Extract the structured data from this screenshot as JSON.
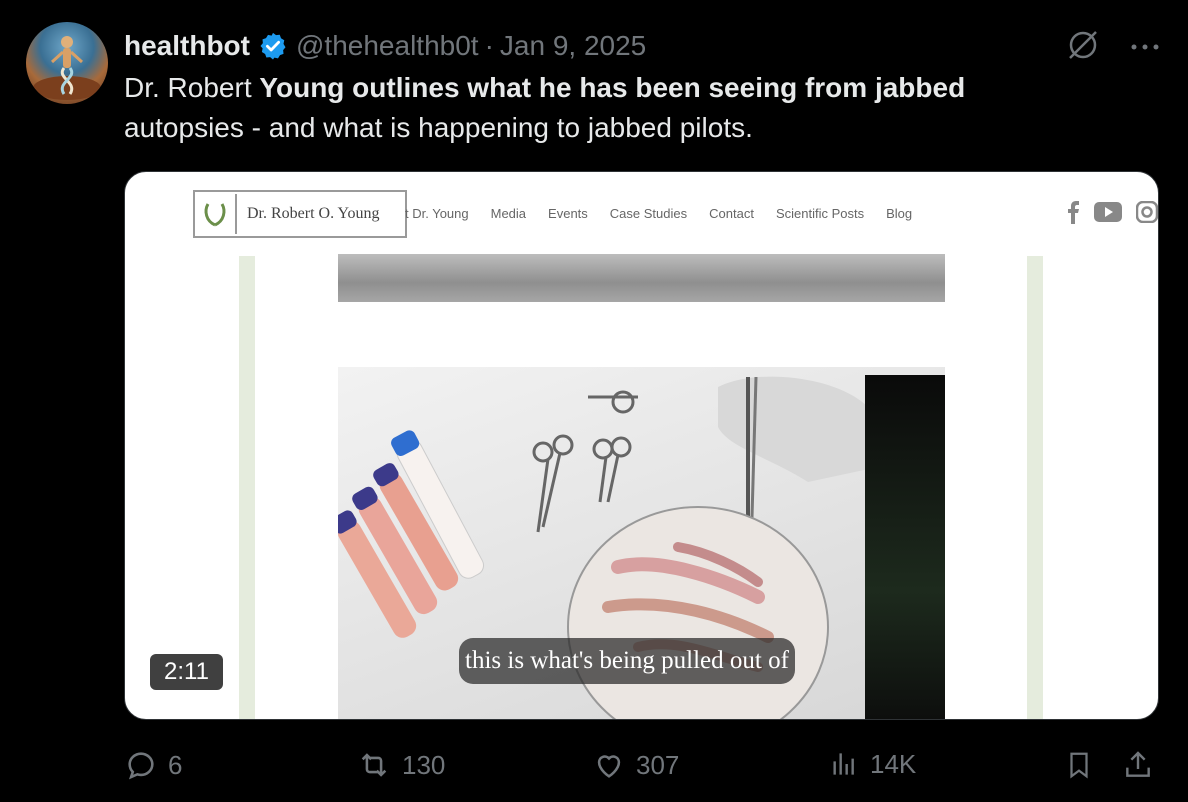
{
  "author": {
    "name": "healthbot",
    "handle": "@thehealthb0t",
    "separator": "·",
    "date": "Jan 9, 2025"
  },
  "tweet": {
    "text_plain_1": "Dr. Robert ",
    "text_bold": "Young outlines what he has been seeing from jabbed",
    "text_plain_2": "autopsies - and what is happening to jabbed pilots."
  },
  "media": {
    "site_name": "Dr. Robert O. Young",
    "nav": [
      "t Dr. Young",
      "Media",
      "Events",
      "Case Studies",
      "Contact",
      "Scientific Posts",
      "Blog"
    ],
    "duration": "2:11",
    "caption": "this is what's being pulled out of"
  },
  "actions": {
    "replies": "6",
    "reposts": "130",
    "likes": "307",
    "views": "14K"
  },
  "colors": {
    "verified": "#1d9bf0",
    "muted": "#71767b",
    "text": "#e7e9ea"
  },
  "icons": [
    "grok-icon",
    "more-icon",
    "reply-icon",
    "repost-icon",
    "like-icon",
    "views-icon",
    "bookmark-icon",
    "share-icon"
  ]
}
